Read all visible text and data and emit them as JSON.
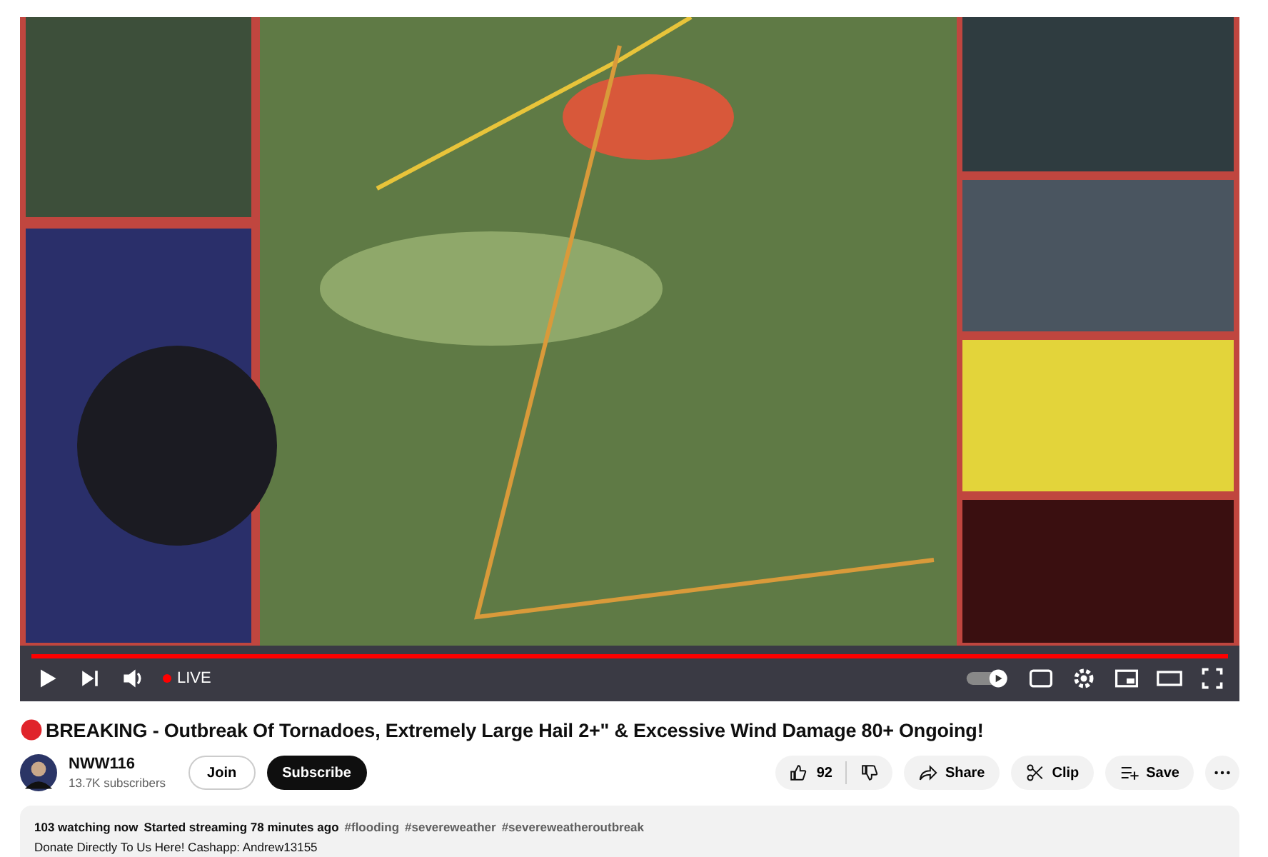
{
  "video": {
    "live_label": "LIVE",
    "live": true,
    "level": 1
  },
  "title": "BREAKING - Outbreak Of Tornadoes, Extremely Large Hail 2+\" & Excessive Wind Damage 80+ Ongoing!",
  "channel": {
    "name": "NWW116",
    "subscribers": "13.7K subscribers"
  },
  "actions": {
    "join": "Join",
    "subscribe": "Subscribe",
    "likes": "92",
    "share": "Share",
    "clip": "Clip",
    "save": "Save"
  },
  "description": {
    "watching": "103 watching now",
    "started": "Started streaming 78 minutes ago",
    "hashtags": [
      "#flooding",
      "#severeweather",
      "#severeweatheroutbreak"
    ],
    "lines": [
      "Donate Directly To Us Here! Cashapp: Andrew13155"
    ]
  }
}
